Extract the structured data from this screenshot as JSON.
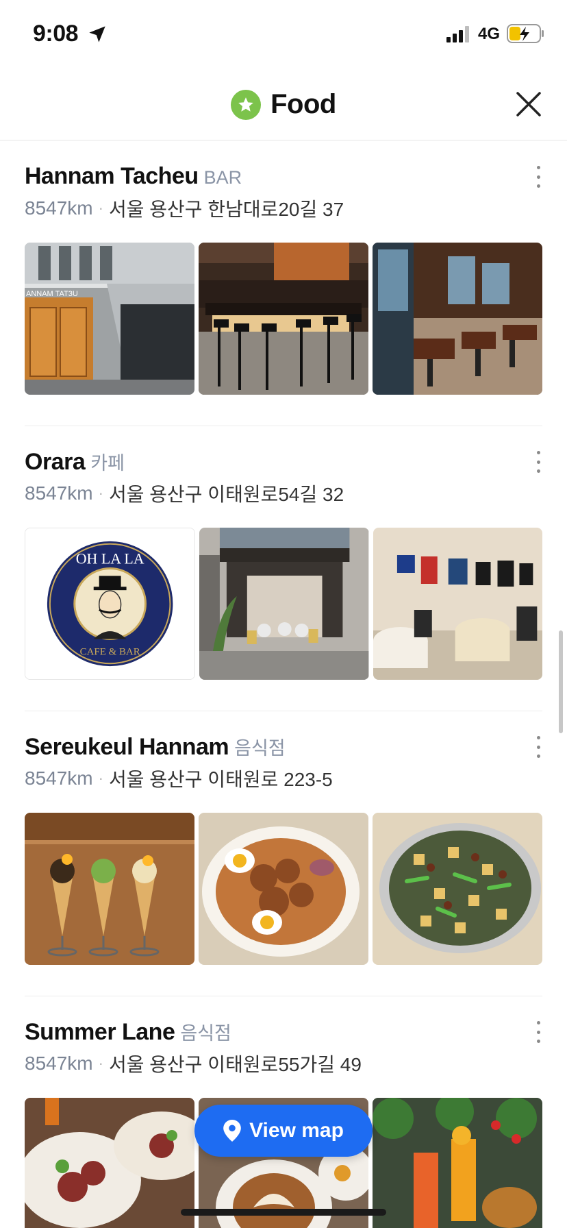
{
  "status_bar": {
    "time": "9:08",
    "network": "4G"
  },
  "header": {
    "title": "Food",
    "icon": "star-icon",
    "close_icon": "close-icon"
  },
  "places": [
    {
      "name": "Hannam Tacheu",
      "category": "BAR",
      "distance": "8547km",
      "separator": "·",
      "address": "서울 용산구 한남대로20길 37",
      "photo_text": "ANNAM TAT3U"
    },
    {
      "name": "Orara",
      "category": "카페",
      "distance": "8547km",
      "separator": "·",
      "address": "서울 용산구 이태원로54길 32",
      "logo_top": "OH LA LA",
      "logo_bottom": "CAFE & BAR"
    },
    {
      "name": "Sereukeul Hannam",
      "category": "음식점",
      "distance": "8547km",
      "separator": "·",
      "address": "서울 용산구 이태원로 223-5"
    },
    {
      "name": "Summer Lane",
      "category": "음식점",
      "distance": "8547km",
      "separator": "·",
      "address": "서울 용산구 이태원로55가길 49"
    }
  ],
  "view_map": {
    "label": "View map",
    "icon": "map-pin-icon"
  },
  "colors": {
    "accent_blue": "#1e6cf2",
    "star_green": "#7cc34b",
    "category_gray": "#8a94a6",
    "distance_gray": "#7b8494"
  }
}
